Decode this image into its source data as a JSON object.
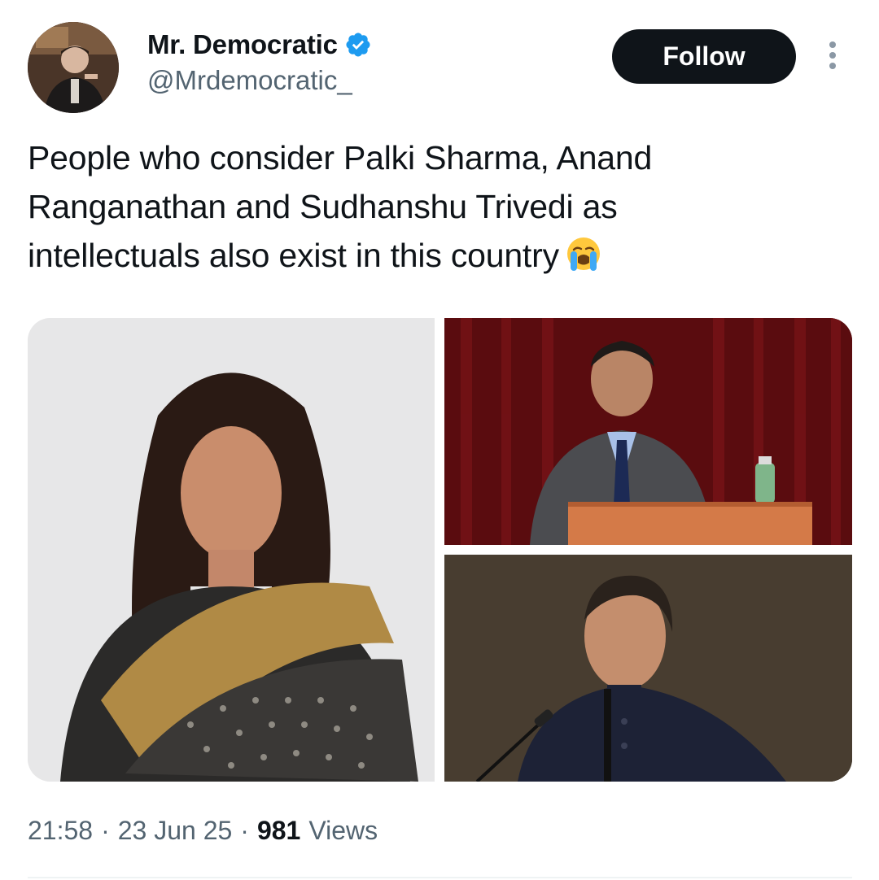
{
  "author": {
    "display_name": "Mr. Democratic",
    "handle": "@Mrdemocratic_",
    "verified": true,
    "avatar_icon": "profile-photo"
  },
  "actions": {
    "follow_label": "Follow",
    "more_icon": "more-vertical-icon"
  },
  "tweet": {
    "text_lines": [
      "People who consider Palki Sharma, Anand",
      "Ranganathan and Sudhanshu Trivedi as",
      "intellectuals also exist in this country"
    ],
    "emoji": "loudly-crying-face"
  },
  "media": [
    {
      "name": "photo-woman-in-saree",
      "background": "#e9e9ea"
    },
    {
      "name": "photo-man-at-podium-red-curtain",
      "background": "#5b0d10"
    },
    {
      "name": "photo-man-speaking-at-microphone",
      "background": "#3a3126"
    }
  ],
  "meta": {
    "time": "21:58",
    "separator": "·",
    "date": "23 Jun 25",
    "views_count": "981",
    "views_label": "Views"
  },
  "colors": {
    "text_primary": "#0f1419",
    "text_secondary": "#536471",
    "verified_blue": "#1d9bf0",
    "follow_bg": "#0f1419"
  }
}
